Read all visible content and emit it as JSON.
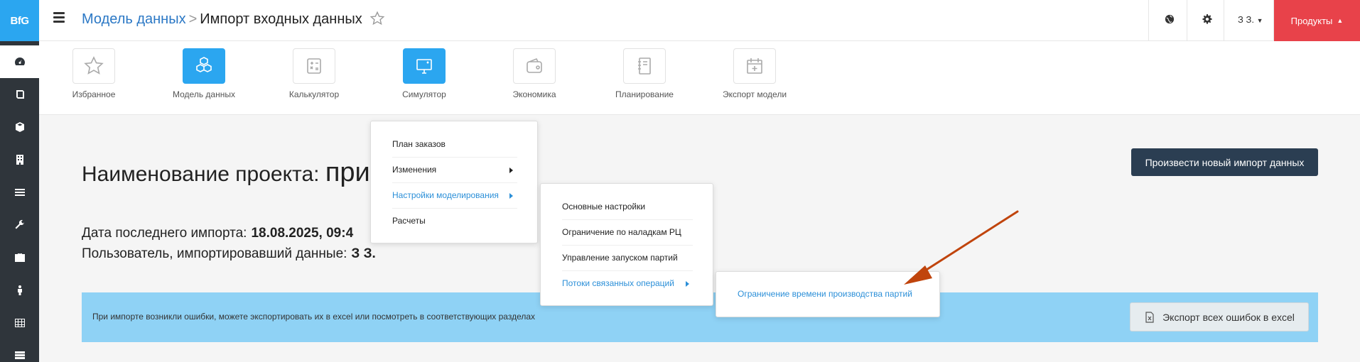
{
  "logo": "BfG",
  "breadcrumb": {
    "parent": "Модель данных",
    "separator": ">",
    "current": "Импорт входных данных"
  },
  "topbar": {
    "user": "З З.",
    "products_label": "Продукты"
  },
  "modules": [
    {
      "label": "Избранное",
      "icon": "star-icon"
    },
    {
      "label": "Модель данных",
      "icon": "cubes-icon"
    },
    {
      "label": "Калькулятор",
      "icon": "calculator-icon"
    },
    {
      "label": "Симулятор",
      "icon": "monitor-icon"
    },
    {
      "label": "Экономика",
      "icon": "wallet-icon"
    },
    {
      "label": "Планирование",
      "icon": "notebook-icon"
    },
    {
      "label": "Экспорт модели",
      "icon": "calendar-plus-icon"
    }
  ],
  "project": {
    "title_label": "Наименование проекта:",
    "title_value": "при",
    "last_import_label": "Дата последнего импорта:",
    "last_import_value": "18.08.2025, 09:4",
    "user_label": "Пользователь, импортировавший данные:",
    "user_value": "З З."
  },
  "new_import_button": "Произвести новый импорт данных",
  "alert": {
    "text": "При импорте возникли ошибки, можете экспортировать их в excel или посмотреть в соответствующих разделах",
    "export_button": "Экспорт всех ошибок в excel"
  },
  "menu1": [
    "План заказов",
    "Изменения",
    "Настройки моделирования",
    "Расчеты"
  ],
  "menu2": [
    "Основные настройки",
    "Ограничение по наладкам РЦ",
    "Управление запуском партий",
    "Потоки связанных операций"
  ],
  "menu3": [
    "Ограничение времени производства партий"
  ],
  "colors": {
    "accent": "#2ba6f0",
    "products": "#e8424a",
    "sidebar": "#2f353b",
    "primary_button": "#2b3e52",
    "alert": "#8fd2f5",
    "annotation_arrow": "#c0440c"
  }
}
